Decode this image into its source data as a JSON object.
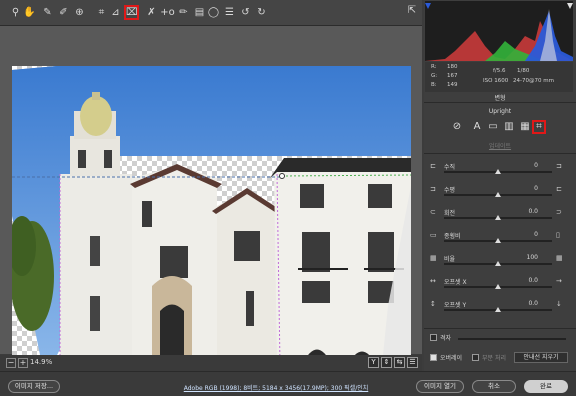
{
  "toolbar": {
    "tools": [
      {
        "name": "zoom-tool-icon",
        "glyph": "⚲"
      },
      {
        "name": "hand-tool-icon",
        "glyph": "✋"
      },
      {
        "name": "white-balance-icon",
        "glyph": "✎"
      },
      {
        "name": "color-sampler-icon",
        "glyph": "✐"
      },
      {
        "name": "targeted-adjustment-icon",
        "glyph": "⊕"
      },
      {
        "name": "crop-tool-icon",
        "glyph": "⌗"
      },
      {
        "name": "straighten-tool-icon",
        "glyph": "⊿"
      },
      {
        "name": "transform-tool-icon",
        "glyph": "⌧"
      },
      {
        "name": "spot-removal-icon",
        "glyph": "✗"
      },
      {
        "name": "red-eye-icon",
        "glyph": "+o"
      },
      {
        "name": "adjustment-brush-icon",
        "glyph": "✏"
      },
      {
        "name": "graduated-filter-icon",
        "glyph": "▤"
      },
      {
        "name": "radial-filter-icon",
        "glyph": "◯"
      },
      {
        "name": "presets-icon",
        "glyph": "☰"
      },
      {
        "name": "rotate-ccw-icon",
        "glyph": "↺"
      },
      {
        "name": "rotate-cw-icon",
        "glyph": "↻"
      }
    ],
    "export_icon": "export-icon"
  },
  "status": {
    "zoom": "14.9%"
  },
  "info": {
    "r_label": "R:",
    "r_val": "180",
    "g_label": "G:",
    "g_val": "167",
    "b_label": "B:",
    "b_val": "149",
    "aperture": "f/5.6",
    "shutter": "1/80",
    "iso": "ISO 1600",
    "lens": "24-70@70 mm"
  },
  "panel": {
    "section": "변형",
    "upright": "Upright",
    "link_label": "업데이트",
    "sliders": [
      {
        "label": "수직",
        "value": "0",
        "pos": 0.5
      },
      {
        "label": "수평",
        "value": "0",
        "pos": 0.5
      },
      {
        "label": "회전",
        "value": "0.0",
        "pos": 0.5
      },
      {
        "label": "종횡비",
        "value": "0",
        "pos": 0.5
      },
      {
        "label": "비율",
        "value": "100",
        "pos": 0.5
      },
      {
        "label": "오프셋 X",
        "value": "0.0",
        "pos": 0.5
      },
      {
        "label": "오프셋 Y",
        "value": "0.0",
        "pos": 0.5
      }
    ],
    "grid_label": "격자",
    "overlay_label": "오버레이",
    "color_label": "부분 처리",
    "guide_button": "안내선 지우기"
  },
  "bottom": {
    "save_button": "이미지 저장...",
    "info_link": "Adobe RGB (1998); 8비트; 5184 x 3456(17.9MP); 300 픽셀/인치",
    "open_button": "이미지 열기",
    "cancel_button": "취소",
    "done_button": "완료"
  }
}
